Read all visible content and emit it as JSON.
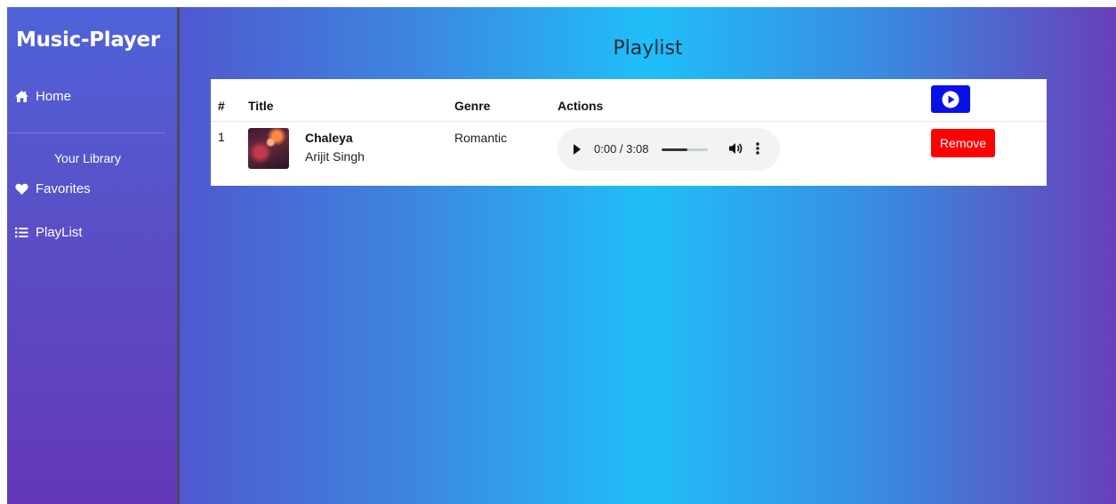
{
  "sidebar": {
    "brand": "Music-Player",
    "items": [
      {
        "label": "Home",
        "icon": "home-icon"
      },
      {
        "label": "Favorites",
        "icon": "heart-icon"
      },
      {
        "label": "PlayList",
        "icon": "list-icon"
      }
    ],
    "library_label": "Your Library"
  },
  "main": {
    "title": "Playlist",
    "table": {
      "columns": [
        "#",
        "Title",
        "Genre",
        "Actions"
      ],
      "play_all_icon": "play-circle-icon",
      "rows": [
        {
          "number": "1",
          "title": "Chaleya",
          "artist": "Arijit Singh",
          "genre": "Romantic",
          "player": {
            "time": "0:00 / 3:08",
            "volume_level": 0.55
          },
          "remove_label": "Remove"
        }
      ]
    }
  },
  "colors": {
    "play_all_button": "#0710e8",
    "remove_button": "#fe0000",
    "gradient_center": "#1fbff8",
    "gradient_edge": "#6840b9"
  }
}
